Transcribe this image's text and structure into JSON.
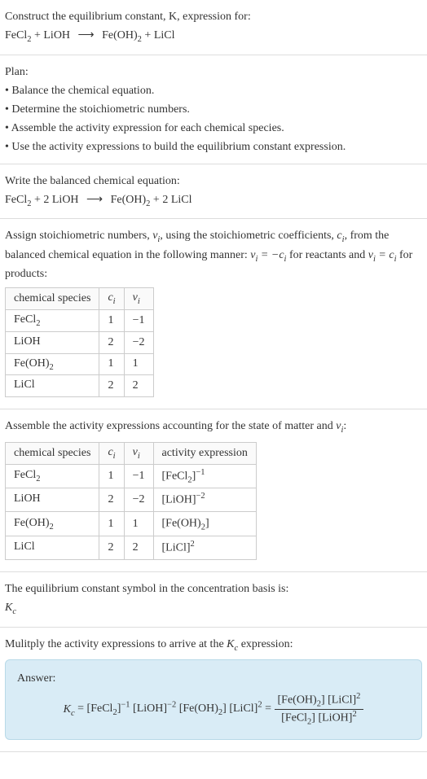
{
  "s1": {
    "l1": "Construct the equilibrium constant, K, expression for:",
    "eq_lhs1": "FeCl",
    "eq_lhs2": " + LiOH",
    "eq_rhs1": "Fe(OH)",
    "eq_rhs2": " + LiCl",
    "arrow": "⟶"
  },
  "s2": {
    "h": "Plan:",
    "b1": "• Balance the chemical equation.",
    "b2": "• Determine the stoichiometric numbers.",
    "b3": "• Assemble the activity expression for each chemical species.",
    "b4": "• Use the activity expressions to build the equilibrium constant expression."
  },
  "s3": {
    "h": "Write the balanced chemical equation:",
    "lhs1": "FeCl",
    "lhs2": " + 2 LiOH",
    "rhs1": "Fe(OH)",
    "rhs2": " + 2 LiCl",
    "arrow": "⟶"
  },
  "s4": {
    "p1a": "Assign stoichiometric numbers, ",
    "p1b": ", using the stoichiometric coefficients, ",
    "p1c": ", from the balanced chemical equation in the following manner: ",
    "p1d": " for reactants and ",
    "p1e": " for products:",
    "nu_i": "ν",
    "c_i": "c",
    "eq_react": " = −",
    "eq_prod": " = ",
    "th1": "chemical species",
    "th2": "c",
    "th3": "ν",
    "rows": [
      {
        "sp": "FeCl",
        "sub": "2",
        "c": "1",
        "nu": "−1"
      },
      {
        "sp": "LiOH",
        "sub": "",
        "c": "2",
        "nu": "−2"
      },
      {
        "sp": "Fe(OH)",
        "sub": "2",
        "c": "1",
        "nu": "1"
      },
      {
        "sp": "LiCl",
        "sub": "",
        "c": "2",
        "nu": "2"
      }
    ]
  },
  "s5": {
    "h": "Assemble the activity expressions accounting for the state of matter and ",
    "h2": ":",
    "th1": "chemical species",
    "th2": "c",
    "th3": "ν",
    "th4": "activity expression",
    "rows": [
      {
        "sp": "FeCl",
        "sub": "2",
        "c": "1",
        "nu": "−1",
        "a1": "[FeCl",
        "asub": "2",
        "a2": "]",
        "asup": "−1"
      },
      {
        "sp": "LiOH",
        "sub": "",
        "c": "2",
        "nu": "−2",
        "a1": "[LiOH]",
        "asub": "",
        "a2": "",
        "asup": "−2"
      },
      {
        "sp": "Fe(OH)",
        "sub": "2",
        "c": "1",
        "nu": "1",
        "a1": "[Fe(OH)",
        "asub": "2",
        "a2": "]",
        "asup": ""
      },
      {
        "sp": "LiCl",
        "sub": "",
        "c": "2",
        "nu": "2",
        "a1": "[LiCl]",
        "asub": "",
        "a2": "",
        "asup": "2"
      }
    ]
  },
  "s6": {
    "l1": "The equilibrium constant symbol in the concentration basis is:",
    "sym": "K",
    "symsub": "c"
  },
  "s7": {
    "l1": "Mulitply the activity expressions to arrive at the ",
    "sym": "K",
    "symsub": "c",
    "l2": " expression:"
  },
  "ans": {
    "label": "Answer:",
    "lhs_sym": "K",
    "lhs_sub": "c",
    "eq": " = ",
    "t1": "[FeCl",
    "t1sub": "2",
    "t1b": "]",
    "t1sup": "−1",
    "t2": " [LiOH]",
    "t2sup": "−2",
    "t3": " [Fe(OH)",
    "t3sub": "2",
    "t3b": "]",
    "t4": " [LiCl]",
    "t4sup": "2",
    "eq2": " = ",
    "num1": "[Fe(OH)",
    "num1sub": "2",
    "num1b": "] [LiCl]",
    "num1sup": "2",
    "den1": "[FeCl",
    "den1sub": "2",
    "den1b": "] [LiOH]",
    "den1sup": "2"
  },
  "sub2": "2",
  "subi": "i"
}
